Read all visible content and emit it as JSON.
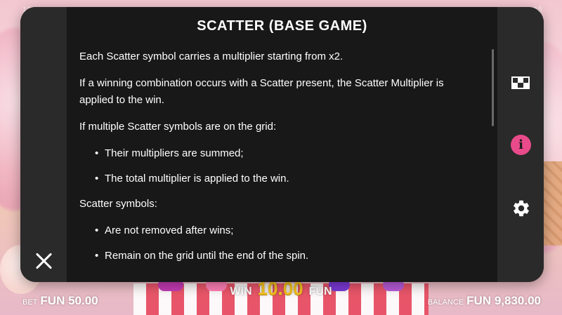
{
  "modal": {
    "title": "SCATTER (BASE GAME)",
    "paragraphs": {
      "p1": "Each Scatter symbol carries a multiplier starting from x2.",
      "p2": "If a winning combination occurs with a Scatter present, the Scatter Multiplier is applied to the win.",
      "p3": "If multiple Scatter symbols are on the grid:",
      "p4": "Scatter symbols:"
    },
    "list1": [
      "Their multipliers are summed;",
      "The total multiplier is applied to the win."
    ],
    "list2": [
      "Are not removed after wins;",
      "Remain on the grid until the end of the spin."
    ]
  },
  "rail": {
    "close_icon": "close-icon",
    "paytable_icon": "paytable-icon",
    "info_icon": "info-icon",
    "info_glyph": "i",
    "settings_icon": "gear-icon"
  },
  "hud": {
    "bet_label": "BET",
    "bet_value": "FUN 50.00",
    "win_label": "WIN",
    "win_value": "10.00",
    "win_currency": "FUN",
    "balance_label": "BALANCE",
    "balance_value": "FUN 9,830.00",
    "corner_left": "12",
    "corner_right": "15"
  },
  "colors": {
    "modal_bg": "#181818",
    "rail_bg": "#2a2a2a",
    "info_accent": "#e84a8a",
    "win_amount": "#f4c020"
  }
}
